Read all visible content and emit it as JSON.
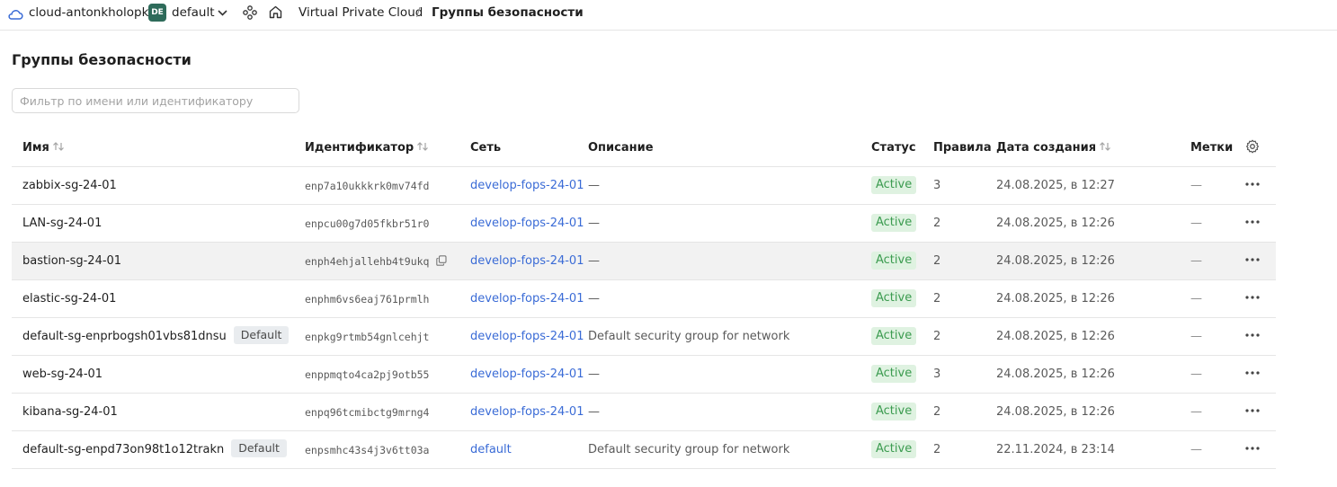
{
  "header": {
    "cloud_name": "cloud-antonkholopko",
    "folder_badge": "DE",
    "folder_name": "default",
    "breadcrumb_service": "Virtual Private Cloud",
    "breadcrumb_sep": "/",
    "breadcrumb_current": "Группы безопасности"
  },
  "page": {
    "title": "Группы безопасности",
    "filter_placeholder": "Фильтр по имени или идентификатору"
  },
  "columns": {
    "name": "Имя",
    "id": "Идентификатор",
    "network": "Сеть",
    "description": "Описание",
    "status": "Статус",
    "rules": "Правила",
    "created": "Дата создания",
    "labels": "Метки"
  },
  "colors": {
    "link": "#3a6bd6",
    "status_bg": "#dff2e1",
    "status_text": "#3b9b4f",
    "folder_badge_bg": "#2e6b5a"
  },
  "rows": [
    {
      "name": "zabbix-sg-24-01",
      "badge": "",
      "id": "enp7a10ukkkrk0mv74fd",
      "network": "develop-fops-24-01",
      "description": "—",
      "status": "Active",
      "rules": "3",
      "created": "24.08.2025, в 12:27",
      "labels": "—"
    },
    {
      "name": "LAN-sg-24-01",
      "badge": "",
      "id": "enpcu00g7d05fkbr51r0",
      "network": "develop-fops-24-01",
      "description": "—",
      "status": "Active",
      "rules": "2",
      "created": "24.08.2025, в 12:26",
      "labels": "—"
    },
    {
      "name": "bastion-sg-24-01",
      "badge": "",
      "id": "enph4ehjallehb4t9ukq",
      "network": "develop-fops-24-01",
      "description": "—",
      "status": "Active",
      "rules": "2",
      "created": "24.08.2025, в 12:26",
      "labels": "—",
      "hover": true
    },
    {
      "name": "elastic-sg-24-01",
      "badge": "",
      "id": "enphm6vs6eaj761prmlh",
      "network": "develop-fops-24-01",
      "description": "—",
      "status": "Active",
      "rules": "2",
      "created": "24.08.2025, в 12:26",
      "labels": "—"
    },
    {
      "name": "default-sg-enprbogsh01vbs81dnsu",
      "badge": "Default",
      "id": "enpkg9rtmb54gnlcehjt",
      "network": "develop-fops-24-01",
      "description": "Default security group for network",
      "status": "Active",
      "rules": "2",
      "created": "24.08.2025, в 12:26",
      "labels": "—"
    },
    {
      "name": "web-sg-24-01",
      "badge": "",
      "id": "enppmqto4ca2pj9otb55",
      "network": "develop-fops-24-01",
      "description": "—",
      "status": "Active",
      "rules": "3",
      "created": "24.08.2025, в 12:26",
      "labels": "—"
    },
    {
      "name": "kibana-sg-24-01",
      "badge": "",
      "id": "enpq96tcmibctg9mrng4",
      "network": "develop-fops-24-01",
      "description": "—",
      "status": "Active",
      "rules": "2",
      "created": "24.08.2025, в 12:26",
      "labels": "—"
    },
    {
      "name": "default-sg-enpd73on98t1o12trakn",
      "badge": "Default",
      "id": "enpsmhc43s4j3v6tt03a",
      "network": "default",
      "description": "Default security group for network",
      "status": "Active",
      "rules": "2",
      "created": "22.11.2024, в 23:14",
      "labels": "—"
    }
  ]
}
